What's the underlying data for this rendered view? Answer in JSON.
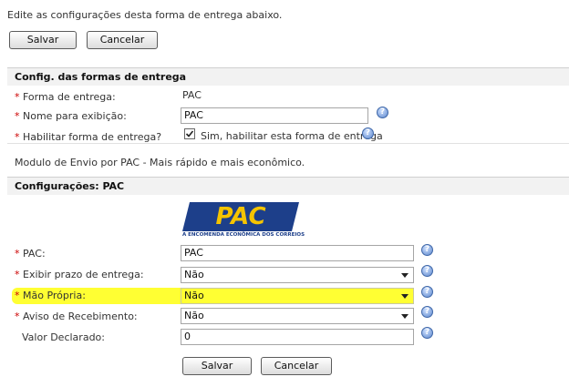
{
  "intro": "Edite as configurações desta forma de entrega abaixo.",
  "buttons": {
    "save": "Salvar",
    "cancel": "Cancelar"
  },
  "section1": {
    "title": "Config. das formas de entrega",
    "fields": {
      "forma": {
        "label": "Forma de entrega:",
        "value": "PAC"
      },
      "nome": {
        "label": "Nome para exibição:",
        "value": "PAC"
      },
      "habilitar": {
        "label": "Habilitar forma de entrega?",
        "checkbox_label": "Sim, habilitar esta forma de entrega",
        "checked": true
      }
    },
    "description": "Modulo de Envio por PAC - Mais rápido e mais econômico."
  },
  "section2": {
    "title": "Configurações: PAC",
    "logo": {
      "text": "PAC",
      "tagline": "A ENCOMENDA ECONÔMICA DOS CORREIOS"
    },
    "fields": {
      "pac": {
        "label": "PAC:",
        "value": "PAC"
      },
      "prazo": {
        "label": "Exibir prazo de entrega:",
        "value": "Não"
      },
      "mao": {
        "label": "Mão Própria:",
        "value": "Não"
      },
      "aviso": {
        "label": "Aviso de Recebimento:",
        "value": "Não"
      },
      "valor": {
        "label": "Valor Declarado:",
        "value": "0"
      }
    }
  },
  "icons": {
    "help": "help-icon",
    "required": "*"
  },
  "colors": {
    "required": "#cc0000",
    "highlight": "#ffff33",
    "logo_bg": "#1d3f8a",
    "logo_text": "#f5c400"
  }
}
